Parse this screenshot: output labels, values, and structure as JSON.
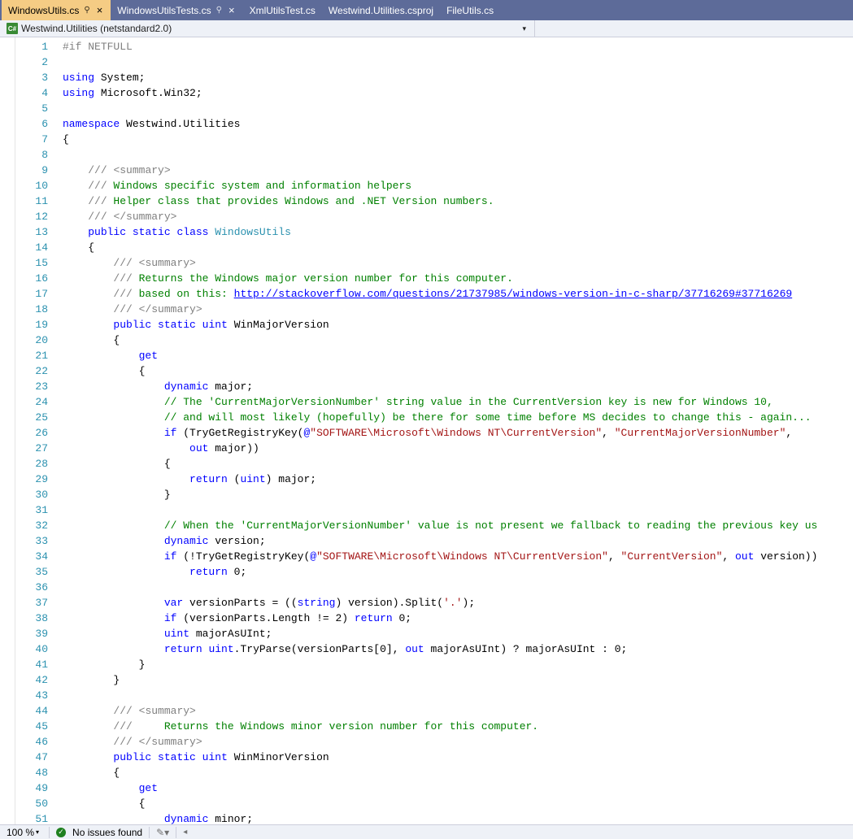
{
  "tabs": [
    {
      "label": "WindowsUtils.cs",
      "active": true,
      "pinned": true
    },
    {
      "label": "WindowsUtilsTests.cs",
      "active": false,
      "pinned": true
    },
    {
      "label": "XmlUtilsTest.cs",
      "active": false,
      "pinned": false
    },
    {
      "label": "Westwind.Utilities.csproj",
      "active": false,
      "pinned": false
    },
    {
      "label": "FileUtils.cs",
      "active": false,
      "pinned": false
    }
  ],
  "nav": {
    "context": "Westwind.Utilities (netstandard2.0)"
  },
  "status": {
    "zoom": "100 %",
    "issues": "No issues found"
  },
  "code": {
    "link": "http://stackoverflow.com/questions/21737985/windows-version-in-c-sharp/37716269#37716269",
    "lines": [
      {
        "n": 1,
        "segs": [
          [
            "c-gray",
            "#if"
          ],
          [
            "c-black",
            " "
          ],
          [
            "c-gray",
            "NETFULL"
          ]
        ]
      },
      {
        "n": 2,
        "segs": []
      },
      {
        "n": 3,
        "segs": [
          [
            "c-blue",
            "using"
          ],
          [
            "c-black",
            " System;"
          ]
        ]
      },
      {
        "n": 4,
        "segs": [
          [
            "c-blue",
            "using"
          ],
          [
            "c-black",
            " Microsoft.Win32;"
          ]
        ]
      },
      {
        "n": 5,
        "segs": []
      },
      {
        "n": 6,
        "segs": [
          [
            "c-blue",
            "namespace"
          ],
          [
            "c-black",
            " Westwind.Utilities"
          ]
        ]
      },
      {
        "n": 7,
        "segs": [
          [
            "c-black",
            "{"
          ]
        ]
      },
      {
        "n": 8,
        "segs": []
      },
      {
        "n": 9,
        "segs": [
          [
            "c-black",
            "    "
          ],
          [
            "c-gray",
            "///"
          ],
          [
            "c-green",
            " "
          ],
          [
            "c-gray",
            "<summary>"
          ]
        ]
      },
      {
        "n": 10,
        "segs": [
          [
            "c-black",
            "    "
          ],
          [
            "c-gray",
            "///"
          ],
          [
            "c-green",
            " Windows specific system and information helpers"
          ]
        ]
      },
      {
        "n": 11,
        "segs": [
          [
            "c-black",
            "    "
          ],
          [
            "c-gray",
            "///"
          ],
          [
            "c-green",
            " Helper class that provides Windows and .NET Version numbers."
          ]
        ]
      },
      {
        "n": 12,
        "segs": [
          [
            "c-black",
            "    "
          ],
          [
            "c-gray",
            "///"
          ],
          [
            "c-green",
            " "
          ],
          [
            "c-gray",
            "</summary>"
          ]
        ]
      },
      {
        "n": 13,
        "segs": [
          [
            "c-black",
            "    "
          ],
          [
            "c-blue",
            "public"
          ],
          [
            "c-black",
            " "
          ],
          [
            "c-blue",
            "static"
          ],
          [
            "c-black",
            " "
          ],
          [
            "c-blue",
            "class"
          ],
          [
            "c-black",
            " "
          ],
          [
            "c-type",
            "WindowsUtils"
          ]
        ]
      },
      {
        "n": 14,
        "segs": [
          [
            "c-black",
            "    {"
          ]
        ]
      },
      {
        "n": 15,
        "segs": [
          [
            "c-black",
            "        "
          ],
          [
            "c-gray",
            "///"
          ],
          [
            "c-green",
            " "
          ],
          [
            "c-gray",
            "<summary>"
          ]
        ]
      },
      {
        "n": 16,
        "segs": [
          [
            "c-black",
            "        "
          ],
          [
            "c-gray",
            "///"
          ],
          [
            "c-green",
            " Returns the Windows major version number for this computer."
          ]
        ]
      },
      {
        "n": 17,
        "segs": [
          [
            "c-black",
            "        "
          ],
          [
            "c-gray",
            "///"
          ],
          [
            "c-green",
            " based on this: "
          ],
          [
            "link",
            ""
          ]
        ]
      },
      {
        "n": 18,
        "segs": [
          [
            "c-black",
            "        "
          ],
          [
            "c-gray",
            "///"
          ],
          [
            "c-green",
            " "
          ],
          [
            "c-gray",
            "</summary>"
          ]
        ]
      },
      {
        "n": 19,
        "segs": [
          [
            "c-black",
            "        "
          ],
          [
            "c-blue",
            "public"
          ],
          [
            "c-black",
            " "
          ],
          [
            "c-blue",
            "static"
          ],
          [
            "c-black",
            " "
          ],
          [
            "c-blue",
            "uint"
          ],
          [
            "c-black",
            " WinMajorVersion"
          ]
        ]
      },
      {
        "n": 20,
        "segs": [
          [
            "c-black",
            "        {"
          ]
        ]
      },
      {
        "n": 21,
        "segs": [
          [
            "c-black",
            "            "
          ],
          [
            "c-blue",
            "get"
          ]
        ]
      },
      {
        "n": 22,
        "segs": [
          [
            "c-black",
            "            {"
          ]
        ]
      },
      {
        "n": 23,
        "segs": [
          [
            "c-black",
            "                "
          ],
          [
            "c-blue",
            "dynamic"
          ],
          [
            "c-black",
            " major;"
          ]
        ]
      },
      {
        "n": 24,
        "segs": [
          [
            "c-black",
            "                "
          ],
          [
            "c-green",
            "// The 'CurrentMajorVersionNumber' string value in the CurrentVersion key is new for Windows 10,"
          ]
        ]
      },
      {
        "n": 25,
        "segs": [
          [
            "c-black",
            "                "
          ],
          [
            "c-green",
            "// and will most likely (hopefully) be there for some time before MS decides to change this - again..."
          ]
        ]
      },
      {
        "n": 26,
        "segs": [
          [
            "c-black",
            "                "
          ],
          [
            "c-blue",
            "if"
          ],
          [
            "c-black",
            " (TryGetRegistryKey("
          ],
          [
            "c-blue",
            "@"
          ],
          [
            "c-str",
            "\"SOFTWARE\\Microsoft\\Windows NT\\CurrentVersion\""
          ],
          [
            "c-black",
            ", "
          ],
          [
            "c-str",
            "\"CurrentMajorVersionNumber\""
          ],
          [
            "c-black",
            ","
          ]
        ]
      },
      {
        "n": 27,
        "segs": [
          [
            "c-black",
            "                    "
          ],
          [
            "c-blue",
            "out"
          ],
          [
            "c-black",
            " major))"
          ]
        ]
      },
      {
        "n": 28,
        "segs": [
          [
            "c-black",
            "                {"
          ]
        ]
      },
      {
        "n": 29,
        "segs": [
          [
            "c-black",
            "                    "
          ],
          [
            "c-blue",
            "return"
          ],
          [
            "c-black",
            " ("
          ],
          [
            "c-blue",
            "uint"
          ],
          [
            "c-black",
            ") major;"
          ]
        ]
      },
      {
        "n": 30,
        "segs": [
          [
            "c-black",
            "                }"
          ]
        ]
      },
      {
        "n": 31,
        "segs": []
      },
      {
        "n": 32,
        "segs": [
          [
            "c-black",
            "                "
          ],
          [
            "c-green",
            "// When the 'CurrentMajorVersionNumber' value is not present we fallback to reading the previous key us"
          ]
        ]
      },
      {
        "n": 33,
        "segs": [
          [
            "c-black",
            "                "
          ],
          [
            "c-blue",
            "dynamic"
          ],
          [
            "c-black",
            " version;"
          ]
        ]
      },
      {
        "n": 34,
        "segs": [
          [
            "c-black",
            "                "
          ],
          [
            "c-blue",
            "if"
          ],
          [
            "c-black",
            " (!TryGetRegistryKey("
          ],
          [
            "c-blue",
            "@"
          ],
          [
            "c-str",
            "\"SOFTWARE\\Microsoft\\Windows NT\\CurrentVersion\""
          ],
          [
            "c-black",
            ", "
          ],
          [
            "c-str",
            "\"CurrentVersion\""
          ],
          [
            "c-black",
            ", "
          ],
          [
            "c-blue",
            "out"
          ],
          [
            "c-black",
            " version))"
          ]
        ]
      },
      {
        "n": 35,
        "segs": [
          [
            "c-black",
            "                    "
          ],
          [
            "c-blue",
            "return"
          ],
          [
            "c-black",
            " 0;"
          ]
        ]
      },
      {
        "n": 36,
        "segs": []
      },
      {
        "n": 37,
        "segs": [
          [
            "c-black",
            "                "
          ],
          [
            "c-blue",
            "var"
          ],
          [
            "c-black",
            " versionParts = (("
          ],
          [
            "c-blue",
            "string"
          ],
          [
            "c-black",
            ") version).Split("
          ],
          [
            "c-str",
            "'.'"
          ],
          [
            "c-black",
            ");"
          ]
        ]
      },
      {
        "n": 38,
        "segs": [
          [
            "c-black",
            "                "
          ],
          [
            "c-blue",
            "if"
          ],
          [
            "c-black",
            " (versionParts.Length != 2) "
          ],
          [
            "c-blue",
            "return"
          ],
          [
            "c-black",
            " 0;"
          ]
        ]
      },
      {
        "n": 39,
        "segs": [
          [
            "c-black",
            "                "
          ],
          [
            "c-blue",
            "uint"
          ],
          [
            "c-black",
            " majorAsUInt;"
          ]
        ]
      },
      {
        "n": 40,
        "segs": [
          [
            "c-black",
            "                "
          ],
          [
            "c-blue",
            "return"
          ],
          [
            "c-black",
            " "
          ],
          [
            "c-blue",
            "uint"
          ],
          [
            "c-black",
            ".TryParse(versionParts[0], "
          ],
          [
            "c-blue",
            "out"
          ],
          [
            "c-black",
            " majorAsUInt) ? majorAsUInt : 0;"
          ]
        ]
      },
      {
        "n": 41,
        "segs": [
          [
            "c-black",
            "            }"
          ]
        ]
      },
      {
        "n": 42,
        "segs": [
          [
            "c-black",
            "        }"
          ]
        ]
      },
      {
        "n": 43,
        "segs": []
      },
      {
        "n": 44,
        "segs": [
          [
            "c-black",
            "        "
          ],
          [
            "c-gray",
            "///"
          ],
          [
            "c-green",
            " "
          ],
          [
            "c-gray",
            "<summary>"
          ]
        ]
      },
      {
        "n": 45,
        "segs": [
          [
            "c-black",
            "        "
          ],
          [
            "c-gray",
            "///"
          ],
          [
            "c-green",
            "     Returns the Windows minor version number for this computer."
          ]
        ]
      },
      {
        "n": 46,
        "segs": [
          [
            "c-black",
            "        "
          ],
          [
            "c-gray",
            "///"
          ],
          [
            "c-green",
            " "
          ],
          [
            "c-gray",
            "</summary>"
          ]
        ]
      },
      {
        "n": 47,
        "segs": [
          [
            "c-black",
            "        "
          ],
          [
            "c-blue",
            "public"
          ],
          [
            "c-black",
            " "
          ],
          [
            "c-blue",
            "static"
          ],
          [
            "c-black",
            " "
          ],
          [
            "c-blue",
            "uint"
          ],
          [
            "c-black",
            " WinMinorVersion"
          ]
        ]
      },
      {
        "n": 48,
        "segs": [
          [
            "c-black",
            "        {"
          ]
        ]
      },
      {
        "n": 49,
        "segs": [
          [
            "c-black",
            "            "
          ],
          [
            "c-blue",
            "get"
          ]
        ]
      },
      {
        "n": 50,
        "segs": [
          [
            "c-black",
            "            {"
          ]
        ]
      },
      {
        "n": 51,
        "segs": [
          [
            "c-black",
            "                "
          ],
          [
            "c-blue",
            "dynamic"
          ],
          [
            "c-black",
            " minor;"
          ]
        ]
      }
    ]
  }
}
